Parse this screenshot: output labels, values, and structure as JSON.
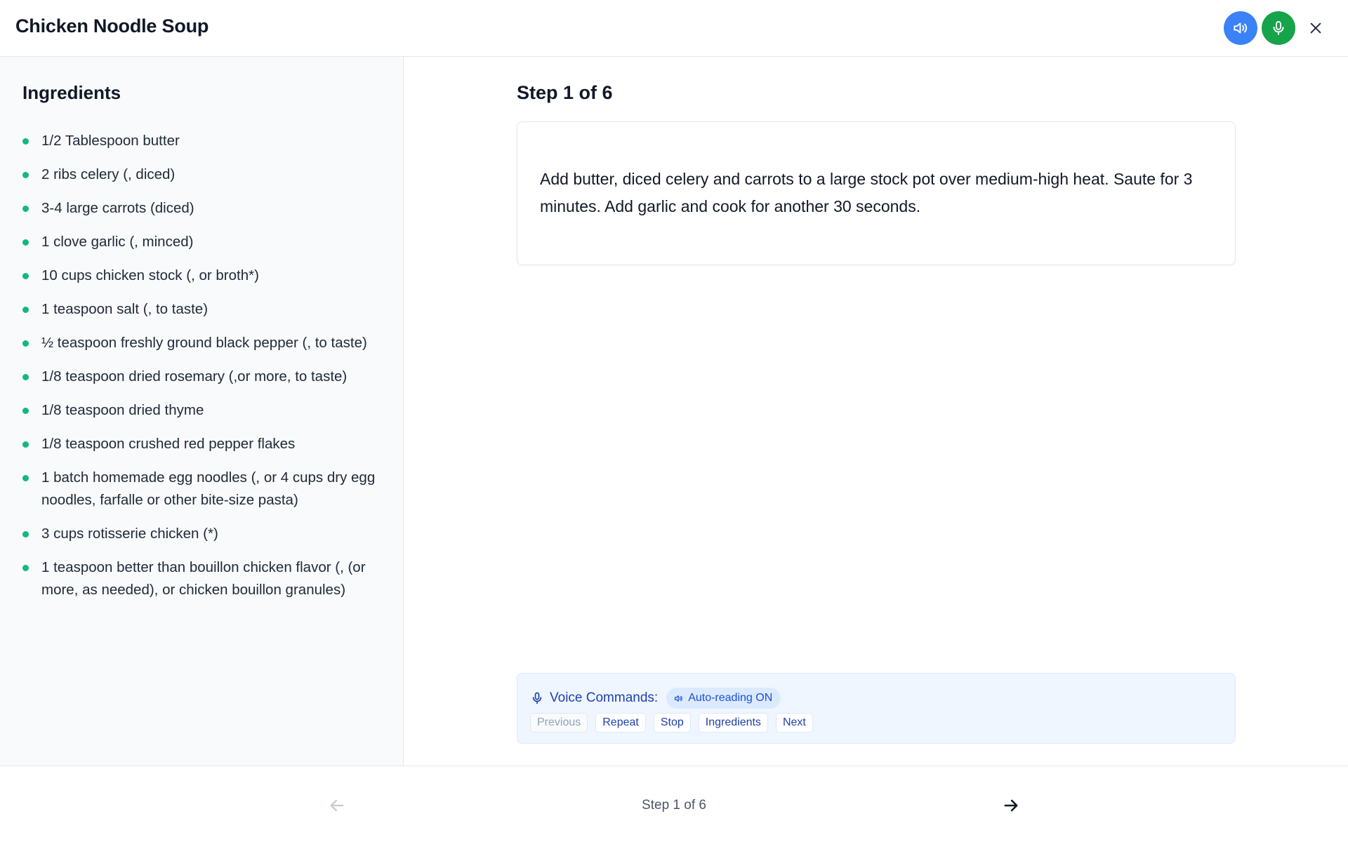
{
  "header": {
    "title": "Chicken Noodle Soup",
    "buttons": [
      "speaker-icon",
      "mic-icon",
      "close-icon"
    ],
    "colors": {
      "speaker": "#3b82f6",
      "mic": "#16a34a"
    }
  },
  "sidebar": {
    "heading": "Ingredients",
    "bullet_color": "#10b981",
    "items": [
      "1/2 Tablespoon butter",
      "2 ribs celery (, diced)",
      "3-4 large carrots (diced)",
      "1 clove garlic (, minced)",
      "10 cups chicken stock (, or broth*)",
      "1 teaspoon salt (, to taste)",
      "½ teaspoon freshly ground black pepper (, to taste)",
      "1/8 teaspoon dried rosemary (,or more, to taste)",
      "1/8 teaspoon dried thyme",
      "1/8 teaspoon crushed red pepper flakes",
      "1 batch homemade egg noodles (, or 4 cups dry egg noodles, farfalle or other bite-size pasta)",
      "3 cups rotisserie chicken (*)",
      "1 teaspoon better than bouillon chicken flavor (, (or more, as needed), or chicken bouillon granules)"
    ]
  },
  "main": {
    "step_heading": "Step 1 of 6",
    "step_text": "Add butter, diced celery and carrots to a large stock pot over medium-high heat. Saute for 3 minutes. Add garlic and cook for another 30 seconds.",
    "voice": {
      "title": "Voice Commands:",
      "auto_badge": "Auto-reading ON",
      "commands": [
        "Previous",
        "Repeat",
        "Stop",
        "Ingredients",
        "Next"
      ],
      "disabled_command": "Previous"
    }
  },
  "footer": {
    "step_label": "Step 1 of 6",
    "prev_enabled": false,
    "next_enabled": true
  }
}
